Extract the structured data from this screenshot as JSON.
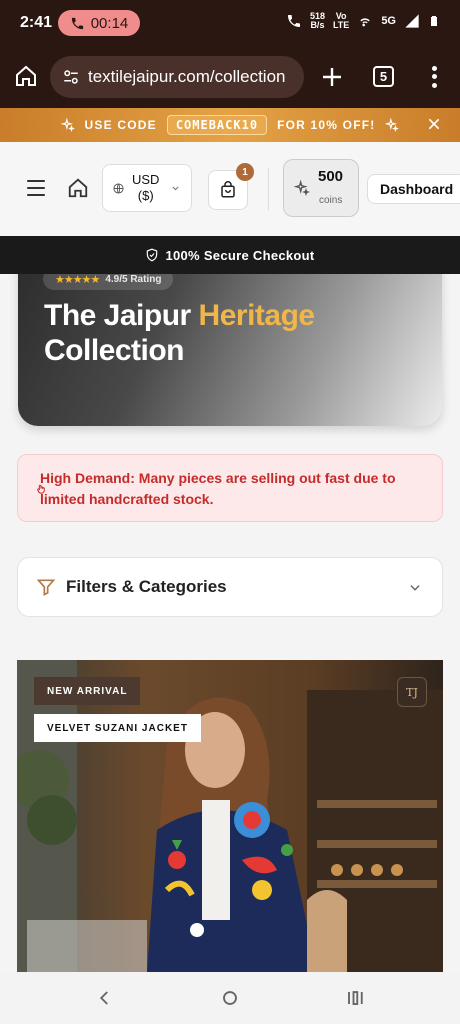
{
  "status_bar": {
    "time": "2:41",
    "call_duration": "00:14",
    "net_speed_value": "518",
    "net_speed_unit": "B/s",
    "volte_top": "Vo",
    "volte_bottom": "LTE",
    "network": "5G"
  },
  "browser": {
    "url": "textilejaipur.com/collection",
    "tab_count": "5"
  },
  "promo": {
    "prefix": "USE CODE",
    "code": "COMEBACK10",
    "suffix": "FOR 10% OFF!"
  },
  "header": {
    "currency_line1": "USD",
    "currency_line2": "($)",
    "cart_count": "1",
    "coins_value": "500",
    "coins_label": "coins",
    "dashboard_label": "Dashboard"
  },
  "secure_bar": {
    "text": "100% Secure Checkout"
  },
  "hero": {
    "rating_stars": "★★★★★",
    "rating_text": "4.9/5 Rating",
    "title_line1_a": "The Jaipur ",
    "title_line1_b": "Heritage",
    "title_line2": "Collection"
  },
  "alert": {
    "message": "High Demand: Many pieces are selling out fast due to limited handcrafted stock."
  },
  "filters": {
    "label": "Filters & Categories"
  },
  "product": {
    "badge": "NEW ARRIVAL",
    "name": "VELVET SUZANI JACKET"
  },
  "colors": {
    "browser_bg": "#2a1712",
    "promo_accent": "#e4a245",
    "hero_accent": "#f0b64a",
    "alert_red": "#c42c2c"
  },
  "icons": [
    "phone-icon",
    "wifi-icon",
    "signal-icon",
    "battery-icon",
    "home-icon",
    "tune-icon",
    "plus-icon",
    "more-icon",
    "sparkle-icon",
    "close-icon",
    "menu-icon",
    "globe-icon",
    "chevron-down-icon",
    "cart-icon",
    "shield-icon",
    "hand-icon",
    "funnel-icon",
    "back-icon",
    "home-circle-icon",
    "recents-icon"
  ]
}
